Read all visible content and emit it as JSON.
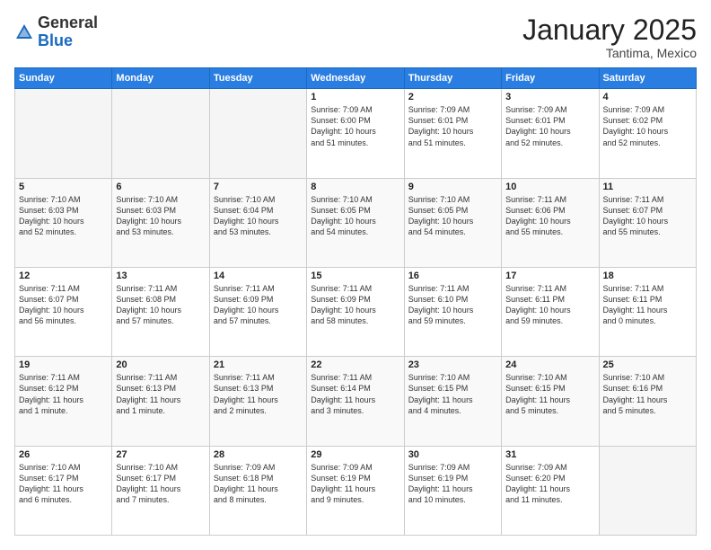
{
  "logo": {
    "general": "General",
    "blue": "Blue"
  },
  "header": {
    "month": "January 2025",
    "location": "Tantima, Mexico"
  },
  "weekdays": [
    "Sunday",
    "Monday",
    "Tuesday",
    "Wednesday",
    "Thursday",
    "Friday",
    "Saturday"
  ],
  "weeks": [
    [
      {
        "day": "",
        "info": ""
      },
      {
        "day": "",
        "info": ""
      },
      {
        "day": "",
        "info": ""
      },
      {
        "day": "1",
        "info": "Sunrise: 7:09 AM\nSunset: 6:00 PM\nDaylight: 10 hours\nand 51 minutes."
      },
      {
        "day": "2",
        "info": "Sunrise: 7:09 AM\nSunset: 6:01 PM\nDaylight: 10 hours\nand 51 minutes."
      },
      {
        "day": "3",
        "info": "Sunrise: 7:09 AM\nSunset: 6:01 PM\nDaylight: 10 hours\nand 52 minutes."
      },
      {
        "day": "4",
        "info": "Sunrise: 7:09 AM\nSunset: 6:02 PM\nDaylight: 10 hours\nand 52 minutes."
      }
    ],
    [
      {
        "day": "5",
        "info": "Sunrise: 7:10 AM\nSunset: 6:03 PM\nDaylight: 10 hours\nand 52 minutes."
      },
      {
        "day": "6",
        "info": "Sunrise: 7:10 AM\nSunset: 6:03 PM\nDaylight: 10 hours\nand 53 minutes."
      },
      {
        "day": "7",
        "info": "Sunrise: 7:10 AM\nSunset: 6:04 PM\nDaylight: 10 hours\nand 53 minutes."
      },
      {
        "day": "8",
        "info": "Sunrise: 7:10 AM\nSunset: 6:05 PM\nDaylight: 10 hours\nand 54 minutes."
      },
      {
        "day": "9",
        "info": "Sunrise: 7:10 AM\nSunset: 6:05 PM\nDaylight: 10 hours\nand 54 minutes."
      },
      {
        "day": "10",
        "info": "Sunrise: 7:11 AM\nSunset: 6:06 PM\nDaylight: 10 hours\nand 55 minutes."
      },
      {
        "day": "11",
        "info": "Sunrise: 7:11 AM\nSunset: 6:07 PM\nDaylight: 10 hours\nand 55 minutes."
      }
    ],
    [
      {
        "day": "12",
        "info": "Sunrise: 7:11 AM\nSunset: 6:07 PM\nDaylight: 10 hours\nand 56 minutes."
      },
      {
        "day": "13",
        "info": "Sunrise: 7:11 AM\nSunset: 6:08 PM\nDaylight: 10 hours\nand 57 minutes."
      },
      {
        "day": "14",
        "info": "Sunrise: 7:11 AM\nSunset: 6:09 PM\nDaylight: 10 hours\nand 57 minutes."
      },
      {
        "day": "15",
        "info": "Sunrise: 7:11 AM\nSunset: 6:09 PM\nDaylight: 10 hours\nand 58 minutes."
      },
      {
        "day": "16",
        "info": "Sunrise: 7:11 AM\nSunset: 6:10 PM\nDaylight: 10 hours\nand 59 minutes."
      },
      {
        "day": "17",
        "info": "Sunrise: 7:11 AM\nSunset: 6:11 PM\nDaylight: 10 hours\nand 59 minutes."
      },
      {
        "day": "18",
        "info": "Sunrise: 7:11 AM\nSunset: 6:11 PM\nDaylight: 11 hours\nand 0 minutes."
      }
    ],
    [
      {
        "day": "19",
        "info": "Sunrise: 7:11 AM\nSunset: 6:12 PM\nDaylight: 11 hours\nand 1 minute."
      },
      {
        "day": "20",
        "info": "Sunrise: 7:11 AM\nSunset: 6:13 PM\nDaylight: 11 hours\nand 1 minute."
      },
      {
        "day": "21",
        "info": "Sunrise: 7:11 AM\nSunset: 6:13 PM\nDaylight: 11 hours\nand 2 minutes."
      },
      {
        "day": "22",
        "info": "Sunrise: 7:11 AM\nSunset: 6:14 PM\nDaylight: 11 hours\nand 3 minutes."
      },
      {
        "day": "23",
        "info": "Sunrise: 7:10 AM\nSunset: 6:15 PM\nDaylight: 11 hours\nand 4 minutes."
      },
      {
        "day": "24",
        "info": "Sunrise: 7:10 AM\nSunset: 6:15 PM\nDaylight: 11 hours\nand 5 minutes."
      },
      {
        "day": "25",
        "info": "Sunrise: 7:10 AM\nSunset: 6:16 PM\nDaylight: 11 hours\nand 5 minutes."
      }
    ],
    [
      {
        "day": "26",
        "info": "Sunrise: 7:10 AM\nSunset: 6:17 PM\nDaylight: 11 hours\nand 6 minutes."
      },
      {
        "day": "27",
        "info": "Sunrise: 7:10 AM\nSunset: 6:17 PM\nDaylight: 11 hours\nand 7 minutes."
      },
      {
        "day": "28",
        "info": "Sunrise: 7:09 AM\nSunset: 6:18 PM\nDaylight: 11 hours\nand 8 minutes."
      },
      {
        "day": "29",
        "info": "Sunrise: 7:09 AM\nSunset: 6:19 PM\nDaylight: 11 hours\nand 9 minutes."
      },
      {
        "day": "30",
        "info": "Sunrise: 7:09 AM\nSunset: 6:19 PM\nDaylight: 11 hours\nand 10 minutes."
      },
      {
        "day": "31",
        "info": "Sunrise: 7:09 AM\nSunset: 6:20 PM\nDaylight: 11 hours\nand 11 minutes."
      },
      {
        "day": "",
        "info": ""
      }
    ]
  ]
}
